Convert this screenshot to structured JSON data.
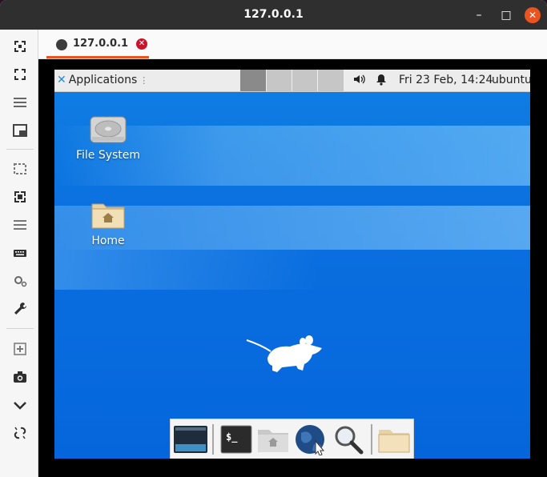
{
  "window": {
    "title": "127.0.0.1",
    "minimize_glyph": "–",
    "maximize_glyph": "□",
    "close_glyph": "✕"
  },
  "tab": {
    "label": "127.0.0.1",
    "close_glyph": "✕"
  },
  "toolbar_icons": [
    "fullscreen-icon",
    "fit-window-icon",
    "menu-icon",
    "window-icon",
    "region-icon",
    "resize-icon",
    "list-icon",
    "keyboard-icon",
    "settings-icon",
    "wrench-icon",
    "new-window-icon",
    "camera-icon",
    "chevron-down-icon",
    "disconnect-icon"
  ],
  "remote_desktop": {
    "panel": {
      "applications_label": "Applications",
      "clock": "Fri 23 Feb, 14:24",
      "user": "ubuntu",
      "workspaces": 4
    },
    "desktop_icons": [
      {
        "label": "File System",
        "icon": "hard-drive-icon"
      },
      {
        "label": "Home",
        "icon": "home-folder-icon"
      }
    ],
    "dock_items": [
      {
        "name": "show-desktop"
      },
      {
        "name": "terminal",
        "text": "$_"
      },
      {
        "name": "file-manager"
      },
      {
        "name": "web-browser"
      },
      {
        "name": "app-finder"
      },
      {
        "name": "folder"
      }
    ]
  },
  "colors": {
    "accent": "#e95420",
    "titlebar": "#2f2f2f",
    "desktop_blue": "#0a6fdf",
    "tab_close": "#c7162b"
  }
}
